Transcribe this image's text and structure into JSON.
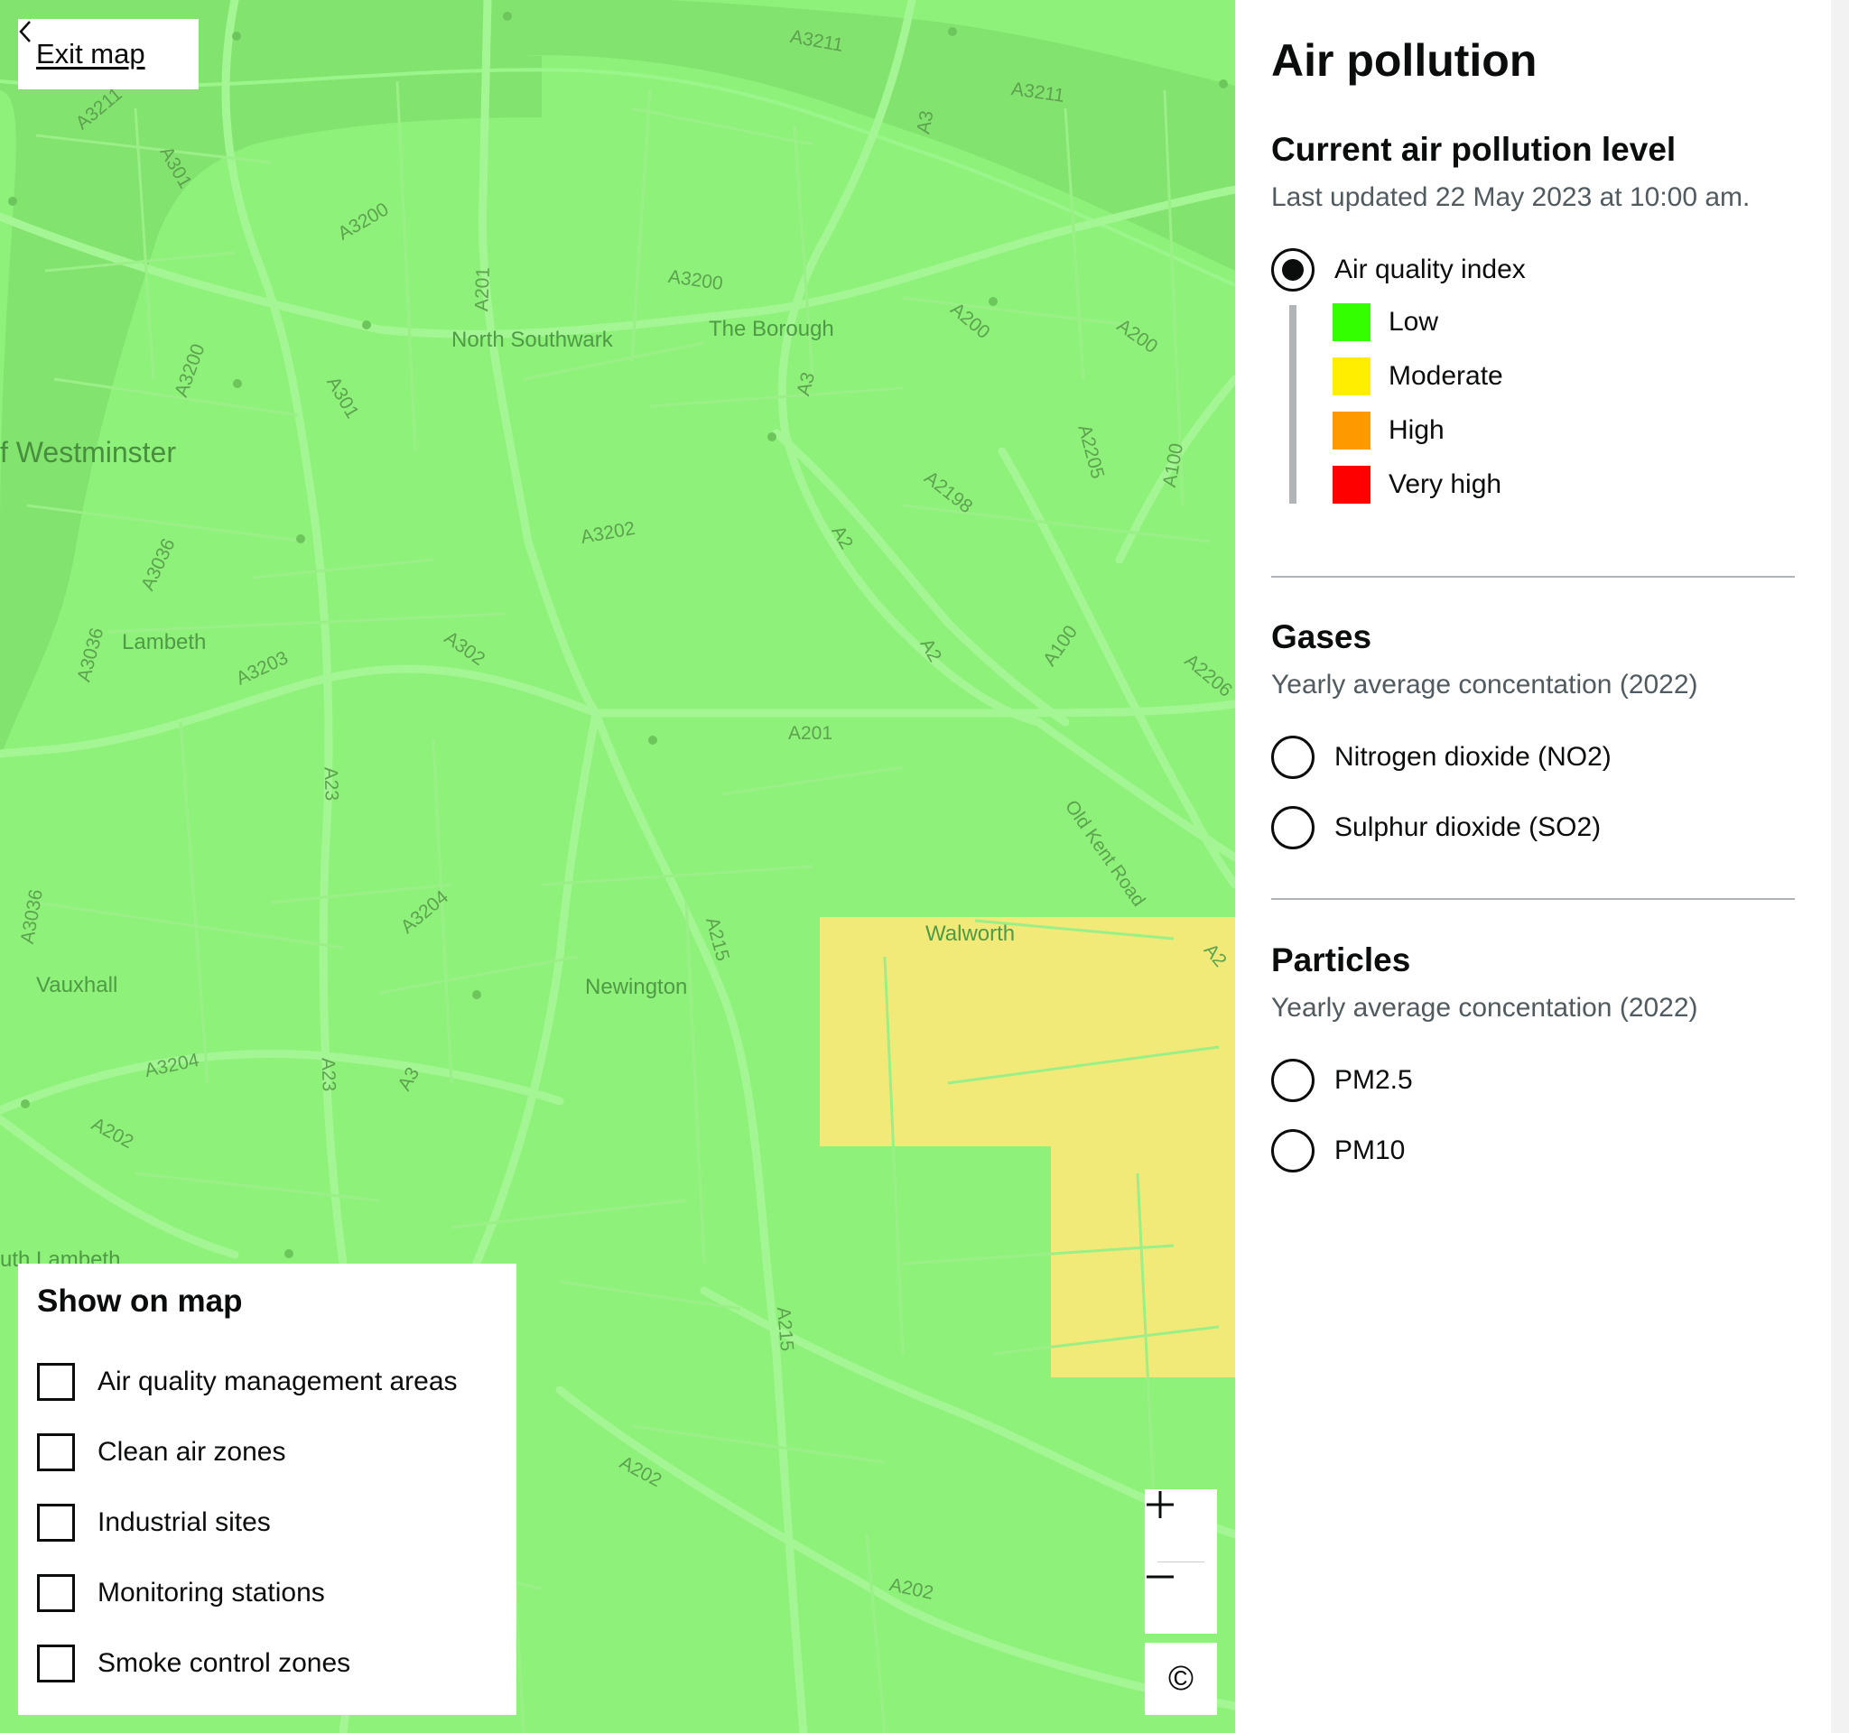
{
  "map": {
    "exit_label": "Exit map",
    "labels": {
      "westminster": "f Westminster",
      "lambeth": "Lambeth",
      "vauxhall": "Vauxhall",
      "north_southwark": "North Southwark",
      "the_borough": "The Borough",
      "walworth": "Walworth",
      "newington": "Newington",
      "south_lambeth": "uth Lambeth",
      "old_kent_road": "Old Kent Road",
      "a3211_a": "A3211",
      "a3211_b": "A3211",
      "a3211_c": "A3211",
      "a301_a": "A301",
      "a301_b": "A301",
      "a3200_a": "A3200",
      "a3200_b": "A3200",
      "a3200_c": "A3200",
      "a201_a": "A201",
      "a201_b": "A201",
      "a3_a": "A3",
      "a3_b": "A3",
      "a3_c": "A3",
      "a200_a": "A200",
      "a200_b": "A200",
      "a2205": "A2205",
      "a100_a": "A100",
      "a100_b": "A100",
      "a2198": "A2198",
      "a2_a": "A2",
      "a2_b": "A2",
      "a2_c": "A2",
      "a3202": "A3202",
      "a3036_a": "A3036",
      "a3036_b": "A3036",
      "a3036_c": "A3036",
      "a302": "A302",
      "a3203": "A3203",
      "a2206": "A2206",
      "a23_a": "A23",
      "a23_b": "A23",
      "a3204_a": "A3204",
      "a3204_b": "A3204",
      "a215_a": "A215",
      "a215_b": "A215",
      "a202_a": "A202",
      "a202_b": "A202",
      "a202_c": "A202"
    },
    "zoom_in_icon": "plus-icon",
    "zoom_out_icon": "minus-icon",
    "attribution_symbol": "©",
    "colors": {
      "low": "#8ef27a",
      "moderate": "#f1ea78"
    }
  },
  "show_on_map": {
    "title": "Show on map",
    "options": [
      {
        "label": "Air quality management areas",
        "checked": false
      },
      {
        "label": "Clean air zones",
        "checked": false
      },
      {
        "label": "Industrial sites",
        "checked": false
      },
      {
        "label": "Monitoring stations",
        "checked": false
      },
      {
        "label": "Smoke control zones",
        "checked": false
      }
    ]
  },
  "panel": {
    "title": "Air pollution",
    "current": {
      "heading": "Current air pollution level",
      "updated": "Last updated 22 May 2023 at 10:00 am.",
      "option": {
        "label": "Air quality index",
        "selected": true
      },
      "legend": [
        {
          "label": "Low",
          "color": "#33ff00"
        },
        {
          "label": "Moderate",
          "color": "#ffee00"
        },
        {
          "label": "High",
          "color": "#ff9900"
        },
        {
          "label": "Very high",
          "color": "#ff0000"
        }
      ]
    },
    "gases": {
      "heading": "Gases",
      "subtitle": "Yearly average concentation (2022)",
      "options": [
        {
          "label": "Nitrogen dioxide (NO2)",
          "selected": false
        },
        {
          "label": "Sulphur dioxide (SO2)",
          "selected": false
        }
      ]
    },
    "particles": {
      "heading": "Particles",
      "subtitle": "Yearly average concentation (2022)",
      "options": [
        {
          "label": "PM2.5",
          "selected": false
        },
        {
          "label": "PM10",
          "selected": false
        }
      ]
    }
  }
}
